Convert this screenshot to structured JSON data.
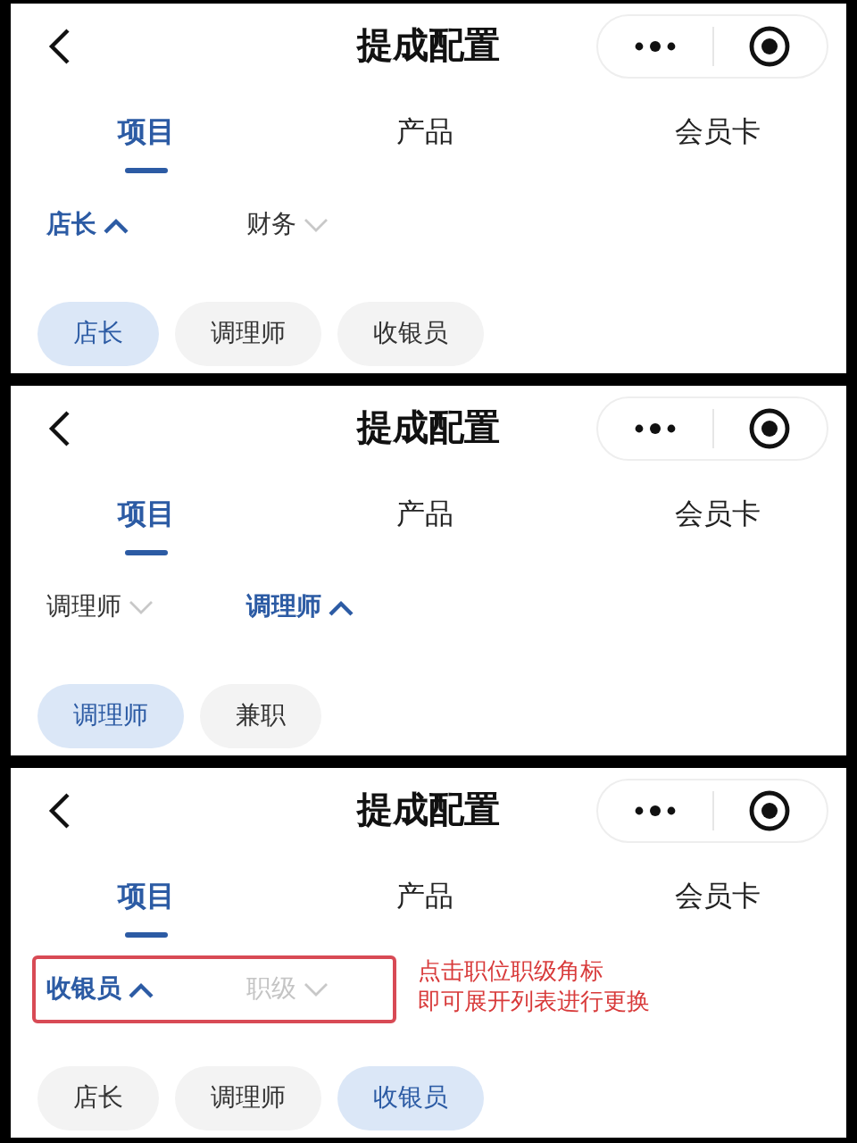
{
  "panels": [
    {
      "title": "提成配置",
      "tabs": [
        {
          "label": "项目",
          "selected": true
        },
        {
          "label": "产品",
          "selected": false
        },
        {
          "label": "会员卡",
          "selected": false
        }
      ],
      "filters_outlined": false,
      "dropdowns": [
        {
          "label": "店长",
          "expanded": true,
          "disabled": false
        },
        {
          "label": "财务",
          "expanded": false,
          "disabled": false
        }
      ],
      "chips": [
        {
          "label": "店长",
          "selected": true
        },
        {
          "label": "调理师",
          "selected": false
        },
        {
          "label": "收银员",
          "selected": false
        }
      ]
    },
    {
      "title": "提成配置",
      "tabs": [
        {
          "label": "项目",
          "selected": true
        },
        {
          "label": "产品",
          "selected": false
        },
        {
          "label": "会员卡",
          "selected": false
        }
      ],
      "filters_outlined": false,
      "dropdowns": [
        {
          "label": "调理师",
          "expanded": false,
          "disabled": false
        },
        {
          "label": "调理师",
          "expanded": true,
          "disabled": false
        }
      ],
      "chips": [
        {
          "label": "调理师",
          "selected": true
        },
        {
          "label": "兼职",
          "selected": false
        }
      ]
    },
    {
      "title": "提成配置",
      "tabs": [
        {
          "label": "项目",
          "selected": true
        },
        {
          "label": "产品",
          "selected": false
        },
        {
          "label": "会员卡",
          "selected": false
        }
      ],
      "filters_outlined": true,
      "dropdowns": [
        {
          "label": "收银员",
          "expanded": true,
          "disabled": false
        },
        {
          "label": "职级",
          "expanded": false,
          "disabled": true
        }
      ],
      "note_lines": [
        "点击职位职级角标",
        "即可展开列表进行更换"
      ],
      "chips": [
        {
          "label": "店长",
          "selected": false
        },
        {
          "label": "调理师",
          "selected": false
        },
        {
          "label": "收银员",
          "selected": true
        }
      ]
    }
  ]
}
